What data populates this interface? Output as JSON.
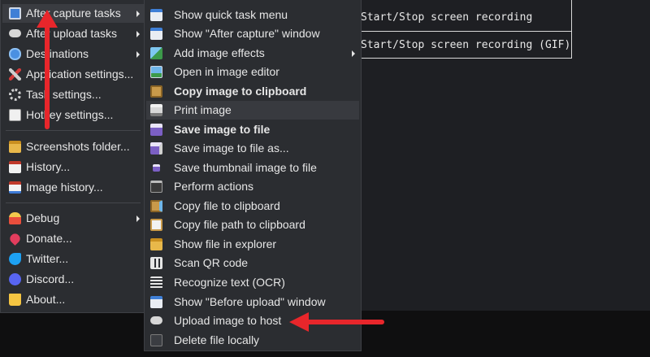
{
  "hotkeys": {
    "row1": "Start/Stop screen recording",
    "row2": "Start/Stop screen recording (GIF)"
  },
  "main_menu": {
    "items": [
      {
        "label": "After capture tasks",
        "icon": "after-capture-icon"
      },
      {
        "label": "After upload tasks",
        "icon": "upload-cloud-icon"
      },
      {
        "label": "Destinations",
        "icon": "destinations-icon"
      },
      {
        "label": "Application settings...",
        "icon": "wrench-icon"
      },
      {
        "label": "Task settings...",
        "icon": "gear-icon"
      },
      {
        "label": "Hotkey settings...",
        "icon": "keyboard-icon"
      },
      {
        "label": "Screenshots folder...",
        "icon": "folder-icon"
      },
      {
        "label": "History...",
        "icon": "history-icon"
      },
      {
        "label": "Image history...",
        "icon": "image-history-icon"
      },
      {
        "label": "Debug",
        "icon": "debug-icon"
      },
      {
        "label": "Donate...",
        "icon": "heart-icon"
      },
      {
        "label": "Twitter...",
        "icon": "twitter-icon"
      },
      {
        "label": "Discord...",
        "icon": "discord-icon"
      },
      {
        "label": "About...",
        "icon": "crown-icon"
      }
    ]
  },
  "sub_menu": {
    "items": [
      {
        "label": "Show quick task menu",
        "icon": "quick-task-icon"
      },
      {
        "label": "Show \"After capture\" window",
        "icon": "window-icon"
      },
      {
        "label": "Add image effects",
        "icon": "image-effects-icon"
      },
      {
        "label": "Open in image editor",
        "icon": "image-editor-icon"
      },
      {
        "label": "Copy image to clipboard",
        "icon": "clipboard-image-icon"
      },
      {
        "label": "Print image",
        "icon": "printer-icon"
      },
      {
        "label": "Save image to file",
        "icon": "save-icon"
      },
      {
        "label": "Save image to file as...",
        "icon": "save-as-icon"
      },
      {
        "label": "Save thumbnail image to file",
        "icon": "thumbnail-icon"
      },
      {
        "label": "Perform actions",
        "icon": "terminal-icon"
      },
      {
        "label": "Copy file to clipboard",
        "icon": "copy-file-icon"
      },
      {
        "label": "Copy file path to clipboard",
        "icon": "copy-path-icon"
      },
      {
        "label": "Show file in explorer",
        "icon": "explorer-folder-icon"
      },
      {
        "label": "Scan QR code",
        "icon": "qr-code-icon"
      },
      {
        "label": "Recognize text (OCR)",
        "icon": "ocr-icon"
      },
      {
        "label": "Show \"Before upload\" window",
        "icon": "before-upload-window-icon"
      },
      {
        "label": "Upload image to host",
        "icon": "upload-cloud-icon"
      },
      {
        "label": "Delete file locally",
        "icon": "delete-icon"
      }
    ]
  },
  "colors": {
    "menu_bg": "#2b2d31",
    "highlight": "#3a3c41",
    "annotation_red": "#e8262b"
  }
}
